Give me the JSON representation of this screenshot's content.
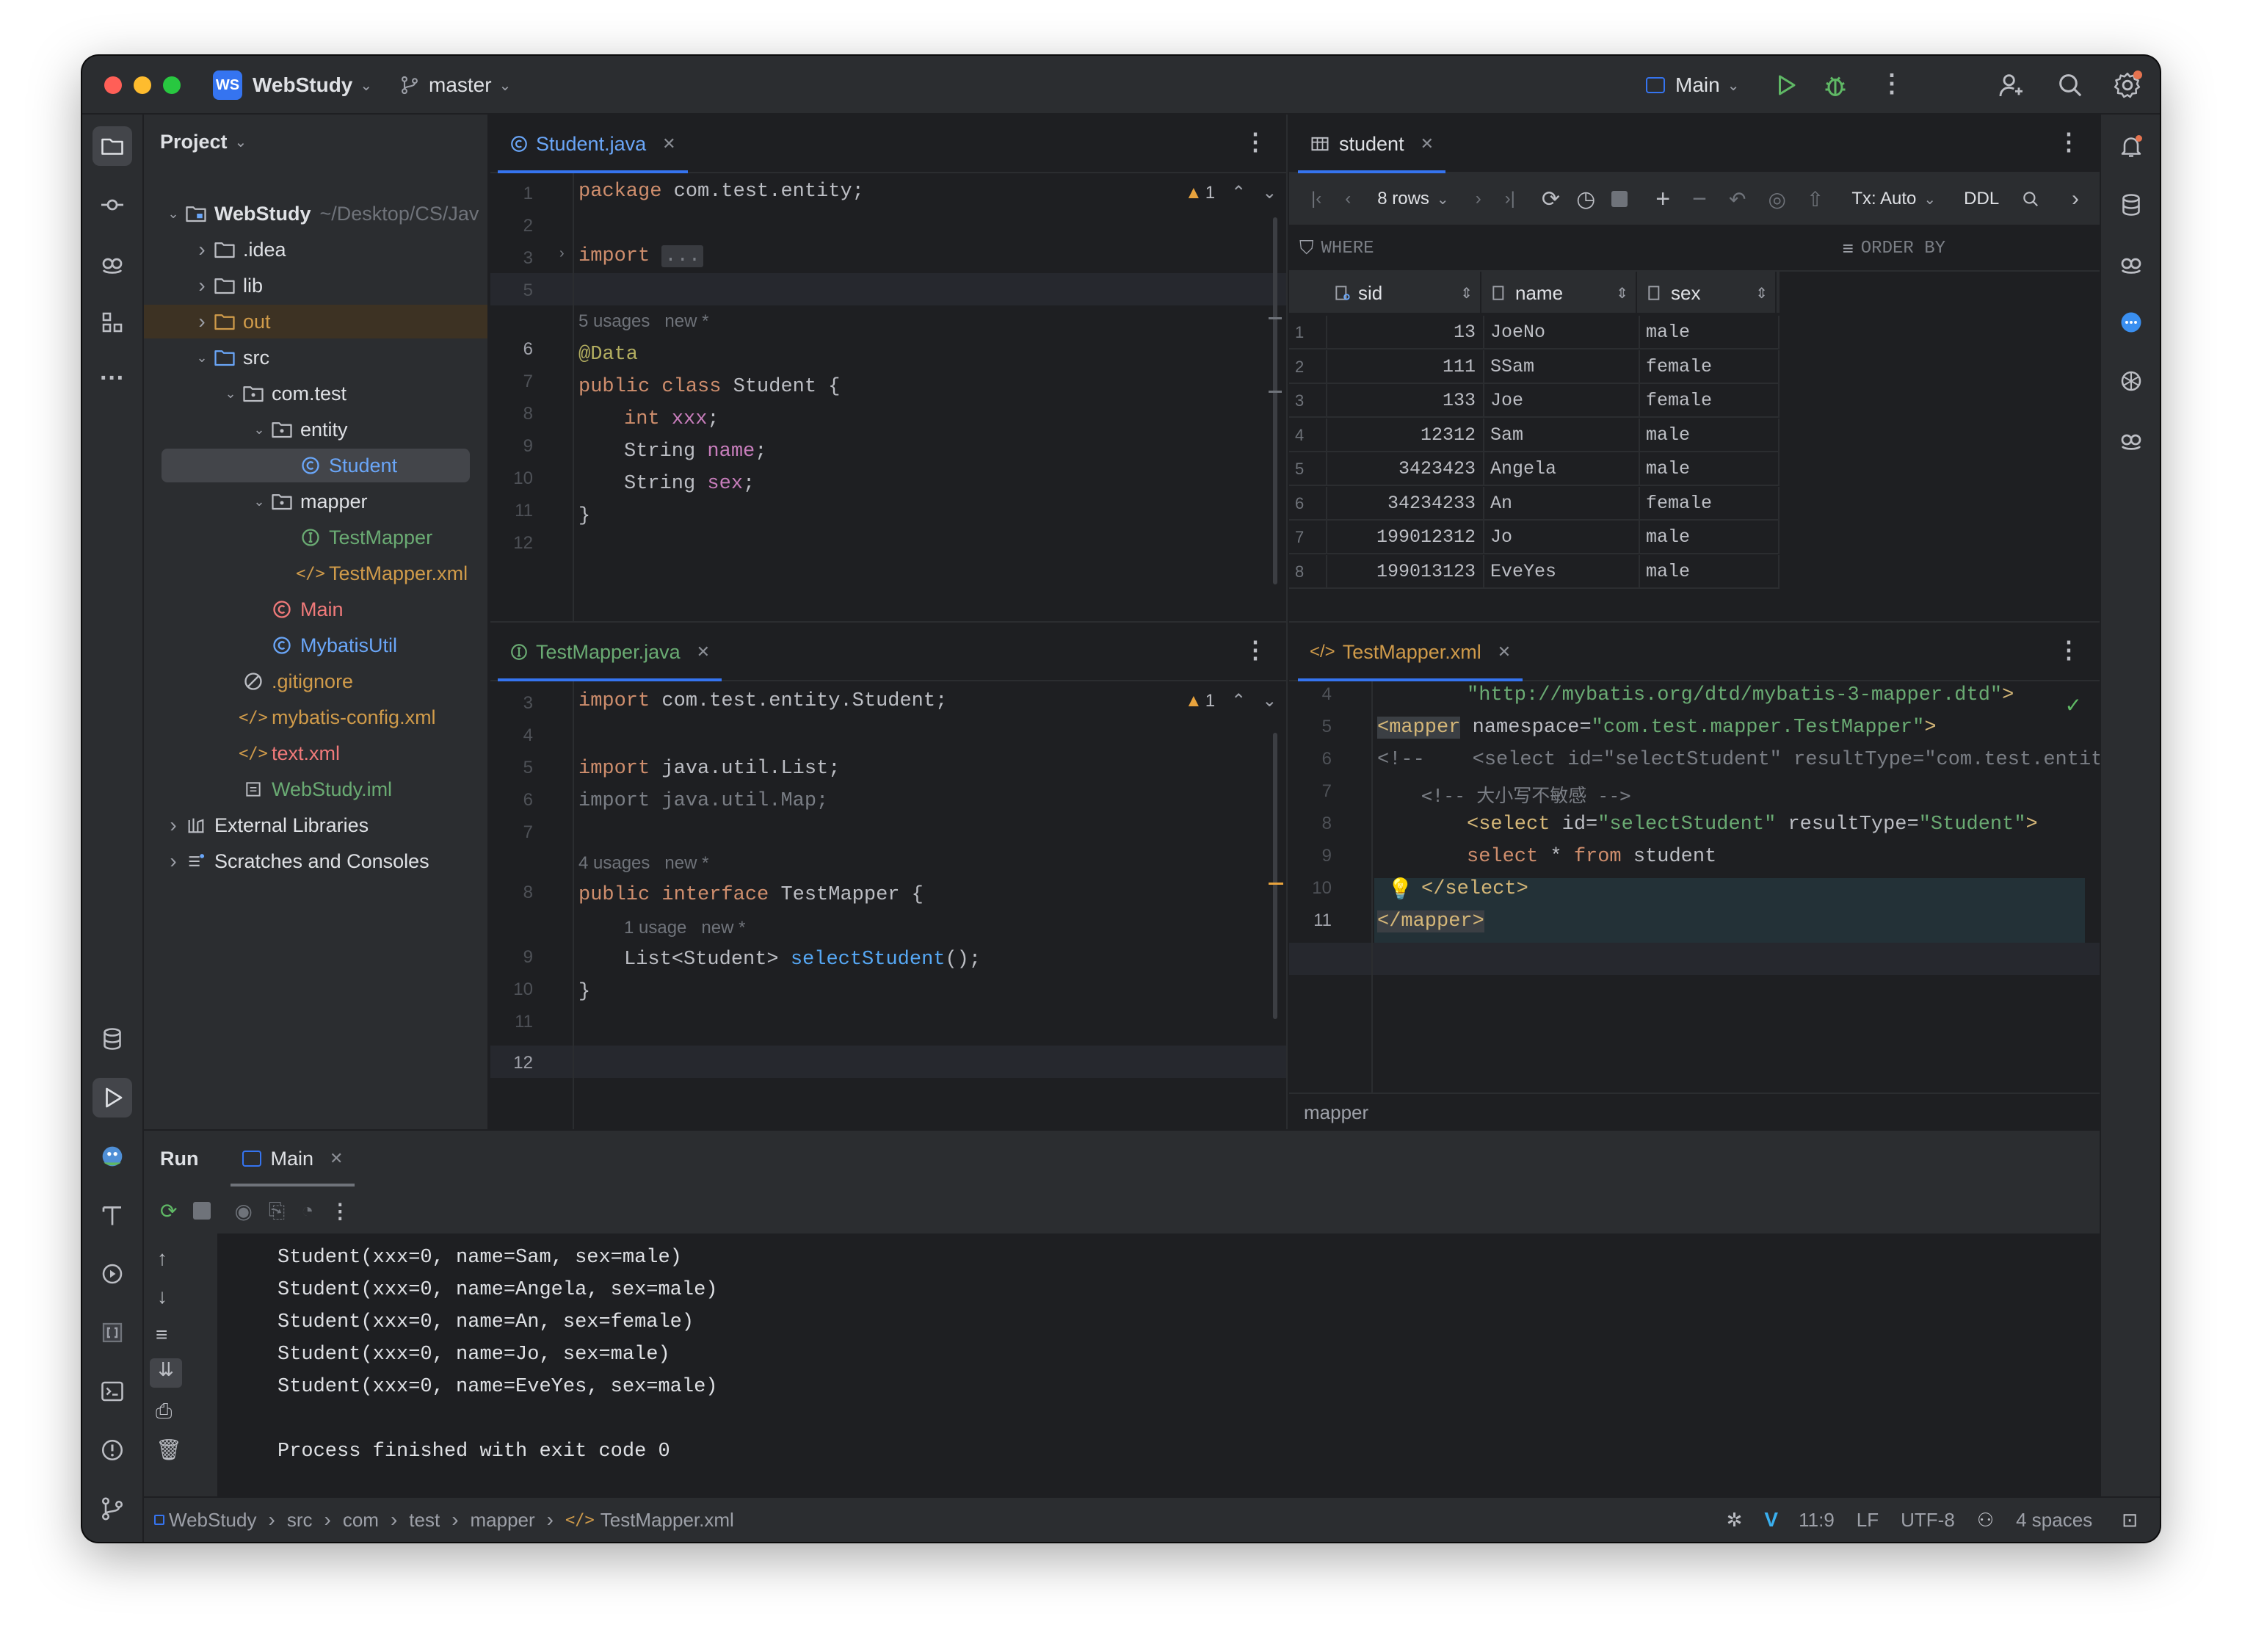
{
  "titlebar": {
    "project_badge": "WS",
    "project_name": "WebStudy",
    "branch": "master",
    "run_config": "Main"
  },
  "project_panel": {
    "title": "Project",
    "tree": [
      {
        "label": "WebStudy",
        "suffix": "~/Desktop/CS/Jav",
        "indent": 0,
        "arrow": "down",
        "icon": "module"
      },
      {
        "label": ".idea",
        "indent": 1,
        "arrow": "right",
        "icon": "folder"
      },
      {
        "label": "lib",
        "indent": 1,
        "arrow": "right",
        "icon": "folder"
      },
      {
        "label": "out",
        "indent": 1,
        "arrow": "right",
        "icon": "folder-out",
        "color": "#d09b4a",
        "highlight": true
      },
      {
        "label": "src",
        "indent": 1,
        "arrow": "down",
        "icon": "folder-src"
      },
      {
        "label": "com.test",
        "indent": 2,
        "arrow": "down",
        "icon": "package"
      },
      {
        "label": "entity",
        "indent": 3,
        "arrow": "down",
        "icon": "package"
      },
      {
        "label": "Student",
        "indent": 4,
        "arrow": "",
        "icon": "class",
        "color": "#6aa6f8",
        "selected": true
      },
      {
        "label": "mapper",
        "indent": 3,
        "arrow": "down",
        "icon": "package"
      },
      {
        "label": "TestMapper",
        "indent": 4,
        "arrow": "",
        "icon": "interface",
        "color": "#6aab73"
      },
      {
        "label": "TestMapper.xml",
        "indent": 4,
        "arrow": "",
        "icon": "xml",
        "color": "#d09b4a"
      },
      {
        "label": "Main",
        "indent": 3,
        "arrow": "",
        "icon": "class",
        "color": "#f07a7a"
      },
      {
        "label": "MybatisUtil",
        "indent": 3,
        "arrow": "",
        "icon": "class",
        "color": "#6aa6f8"
      },
      {
        "label": ".gitignore",
        "indent": 2,
        "arrow": "",
        "icon": "ignore",
        "color": "#d09b4a"
      },
      {
        "label": "mybatis-config.xml",
        "indent": 2,
        "arrow": "",
        "icon": "xml",
        "color": "#d09b4a"
      },
      {
        "label": "text.xml",
        "indent": 2,
        "arrow": "",
        "icon": "xml",
        "color": "#f07a7a"
      },
      {
        "label": "WebStudy.iml",
        "indent": 2,
        "arrow": "",
        "icon": "iml",
        "color": "#6aab73"
      },
      {
        "label": "External Libraries",
        "indent": 0,
        "arrow": "right",
        "icon": "libs"
      },
      {
        "label": "Scratches and Consoles",
        "indent": 0,
        "arrow": "right",
        "icon": "scratch"
      }
    ]
  },
  "editor_student": {
    "tab": "Student.java",
    "warning_count": "1",
    "lines": [
      "1",
      "2",
      "3",
      "5",
      "",
      "6",
      "7",
      "8",
      "9",
      "10",
      "11",
      "12"
    ],
    "code": {
      "l1_kw": "package",
      "l1_rest": " com.test.entity;",
      "l3_kw": "import",
      "l3_fold": "...",
      "hint": "5 usages   new *",
      "l6_ann": "@Data",
      "l7_kw": "public class",
      "l7_rest": " Student {",
      "l8_kw": "int",
      "l8_fld": "xxx",
      "l8_end": ";",
      "l9_ty": "String ",
      "l9_fld": "name",
      "l9_end": ";",
      "l10_ty": "String ",
      "l10_fld": "sex",
      "l10_end": ";",
      "l11": "}"
    }
  },
  "editor_mapper_java": {
    "tab": "TestMapper.java",
    "warning_count": "1",
    "lines": [
      "3",
      "4",
      "5",
      "6",
      "7",
      "",
      "8",
      "",
      "9",
      "10",
      "11",
      "12"
    ],
    "code": {
      "l3_kw": "import",
      "l3_rest": " com.test.entity.Student;",
      "l5_kw": "import",
      "l5_rest": " java.util.List;",
      "l6": "import java.util.Map;",
      "hint1": "4 usages   new *",
      "l8_kw": "public interface",
      "l8_rest": " TestMapper {",
      "hint2": "1 usage   new *",
      "l9_ty": "List<Student> ",
      "l9_fn": "selectStudent",
      "l9_end": "();",
      "l10": "}"
    }
  },
  "db_view": {
    "tab": "student",
    "rows_label": "8 rows",
    "tx_label": "Tx: Auto",
    "ddl_label": "DDL",
    "where_label": "WHERE",
    "order_label": "ORDER BY",
    "columns": [
      "sid",
      "name",
      "sex"
    ],
    "rows": [
      {
        "n": "1",
        "sid": "13",
        "name": "JoeNo",
        "sex": "male"
      },
      {
        "n": "2",
        "sid": "111",
        "name": "SSam",
        "sex": "female"
      },
      {
        "n": "3",
        "sid": "133",
        "name": "Joe",
        "sex": "female"
      },
      {
        "n": "4",
        "sid": "12312",
        "name": "Sam",
        "sex": "male"
      },
      {
        "n": "5",
        "sid": "3423423",
        "name": "Angela",
        "sex": "male"
      },
      {
        "n": "6",
        "sid": "34234233",
        "name": "An",
        "sex": "female"
      },
      {
        "n": "7",
        "sid": "199012312",
        "name": "Jo",
        "sex": "male"
      },
      {
        "n": "8",
        "sid": "199013123",
        "name": "EveYes",
        "sex": "male"
      }
    ]
  },
  "editor_xml": {
    "tab": "TestMapper.xml",
    "lines": [
      "4",
      "5",
      "6",
      "7",
      "8",
      "9",
      "10",
      "11"
    ],
    "breadcrumb": "mapper",
    "code": {
      "l4_str": "\"http://mybatis.org/dtd/mybatis-3-mapper.dtd\"",
      "l4_end": ">",
      "l5_tag": "<mapper",
      "l5_attr": " namespace=",
      "l5_str": "\"com.test.mapper.TestMapper\"",
      "l5_end": ">",
      "l6": "<!--    <select id=\"selectStudent\" resultType=\"com.test.entity.Student\"",
      "l7": "<!-- 大小写不敏感 -->",
      "l8_tag": "<select",
      "l8_a1": " id=",
      "l8_s1": "\"selectStudent\"",
      "l8_a2": " resultType=",
      "l8_s2": "\"Student\"",
      "l8_end": ">",
      "l9_kw1": "select",
      "l9_mid": " * ",
      "l9_kw2": "from",
      "l9_rest": " student",
      "l10_tag": "</select>",
      "l11_tag": "</mapper>"
    }
  },
  "run_panel": {
    "title": "Run",
    "tab": "Main",
    "output": [
      "Student(xxx=0, name=Sam, sex=male)",
      "Student(xxx=0, name=Angela, sex=male)",
      "Student(xxx=0, name=An, sex=female)",
      "Student(xxx=0, name=Jo, sex=male)",
      "Student(xxx=0, name=EveYes, sex=male)",
      "",
      "Process finished with exit code 0"
    ]
  },
  "statusbar": {
    "path": [
      "WebStudy",
      "src",
      "com",
      "test",
      "mapper",
      "TestMapper.xml"
    ],
    "position": "11:9",
    "line_sep": "LF",
    "encoding": "UTF-8",
    "indent": "4 spaces"
  },
  "colors": {
    "accent": "#3574f0",
    "keyword": "#cf8e6d",
    "string": "#6aab73",
    "field": "#c77dbb",
    "warning": "#e8a33d"
  }
}
